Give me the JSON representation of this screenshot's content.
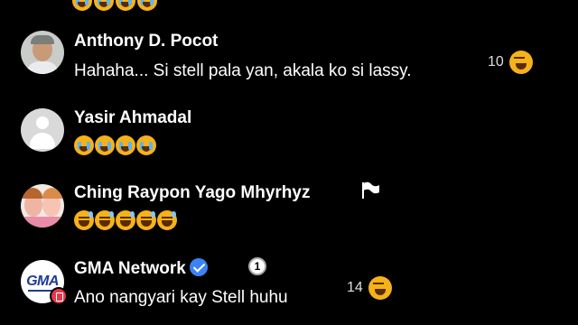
{
  "comments": [
    {
      "author": "Anthony D. Pocot",
      "text": "Hahaha... Si stell pala yan, akala ko si lassy.",
      "reaction_count": "10"
    },
    {
      "author": "Yasir Ahmadal",
      "text": "",
      "emojis": [
        "crying-face",
        "crying-face",
        "crying-face",
        "crying-face"
      ]
    },
    {
      "author": "Ching Raypon Yago Mhyrhyz",
      "text": "",
      "emojis": [
        "grinning-sweat",
        "grinning-sweat",
        "grinning-sweat",
        "grinning-sweat",
        "grinning-sweat"
      ]
    },
    {
      "author": "GMA Network",
      "text": "Ano nangyari kay Stell huhu",
      "reaction_count": "14",
      "verified": true,
      "avatar_logo": "GMA"
    }
  ],
  "colors": {
    "background": "#000000",
    "text": "#ffffff",
    "emoji": "#f5b21b",
    "verified": "#3b82f6"
  }
}
